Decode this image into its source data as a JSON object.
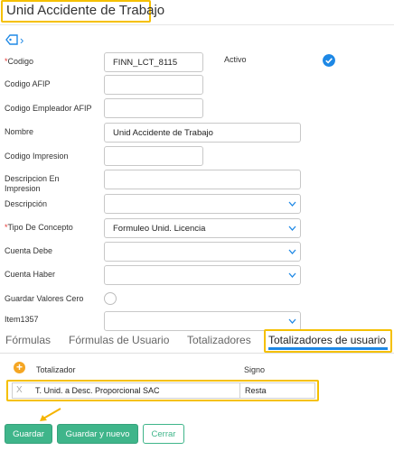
{
  "header": {
    "title": "Unid Accidente de Trabajo"
  },
  "form": {
    "codigo": {
      "label": "Codigo",
      "required_mark": "*",
      "value": "FINN_LCT_8115"
    },
    "activo": {
      "label": "Activo",
      "checked": true
    },
    "codigo_afip": {
      "label": "Codigo AFIP",
      "value": ""
    },
    "codigo_empleador_afip": {
      "label": "Codigo Empleador AFIP",
      "value": ""
    },
    "nombre": {
      "label": "Nombre",
      "value": "Unid Accidente de Trabajo"
    },
    "codigo_impresion": {
      "label": "Codigo Impresion",
      "value": ""
    },
    "descripcion_impresion": {
      "label_line1": "Descripcion En",
      "label_line2": "Impresion",
      "value": ""
    },
    "descripcion": {
      "label": "Descripción",
      "value": ""
    },
    "tipo_concepto": {
      "label": "Tipo De Concepto",
      "required_mark": "*",
      "value": "Formuleo Unid. Licencia"
    },
    "cuenta_debe": {
      "label": "Cuenta Debe",
      "value": ""
    },
    "cuenta_haber": {
      "label": "Cuenta Haber",
      "value": ""
    },
    "guardar_valores_cero": {
      "label": "Guardar Valores Cero",
      "checked": false
    },
    "item1357": {
      "label": "Item1357",
      "value": ""
    }
  },
  "tabs": [
    {
      "label": "Fórmulas"
    },
    {
      "label": "Fórmulas de Usuario"
    },
    {
      "label": "Totalizadores"
    },
    {
      "label": "Totalizadores de usuario",
      "active": true
    }
  ],
  "table": {
    "headers": [
      "Totalizador",
      "Signo"
    ],
    "rows": [
      {
        "remove": "X",
        "totalizador": "T. Unid. a Desc. Proporcional SAC",
        "signo": "Resta"
      }
    ]
  },
  "buttons": {
    "save": "Guardar",
    "save_new": "Guardar y nuevo",
    "close": "Cerrar"
  },
  "colors": {
    "accent": "#1e88e5",
    "highlight": "#f5c000",
    "primary_button": "#3fb58a",
    "add": "#f5a623"
  },
  "icons": [
    "tag-icon",
    "chevron-right-icon",
    "check-circle-icon",
    "add-circle-icon",
    "remove-icon",
    "chevron-down-icon",
    "annotation-arrow-icon"
  ]
}
